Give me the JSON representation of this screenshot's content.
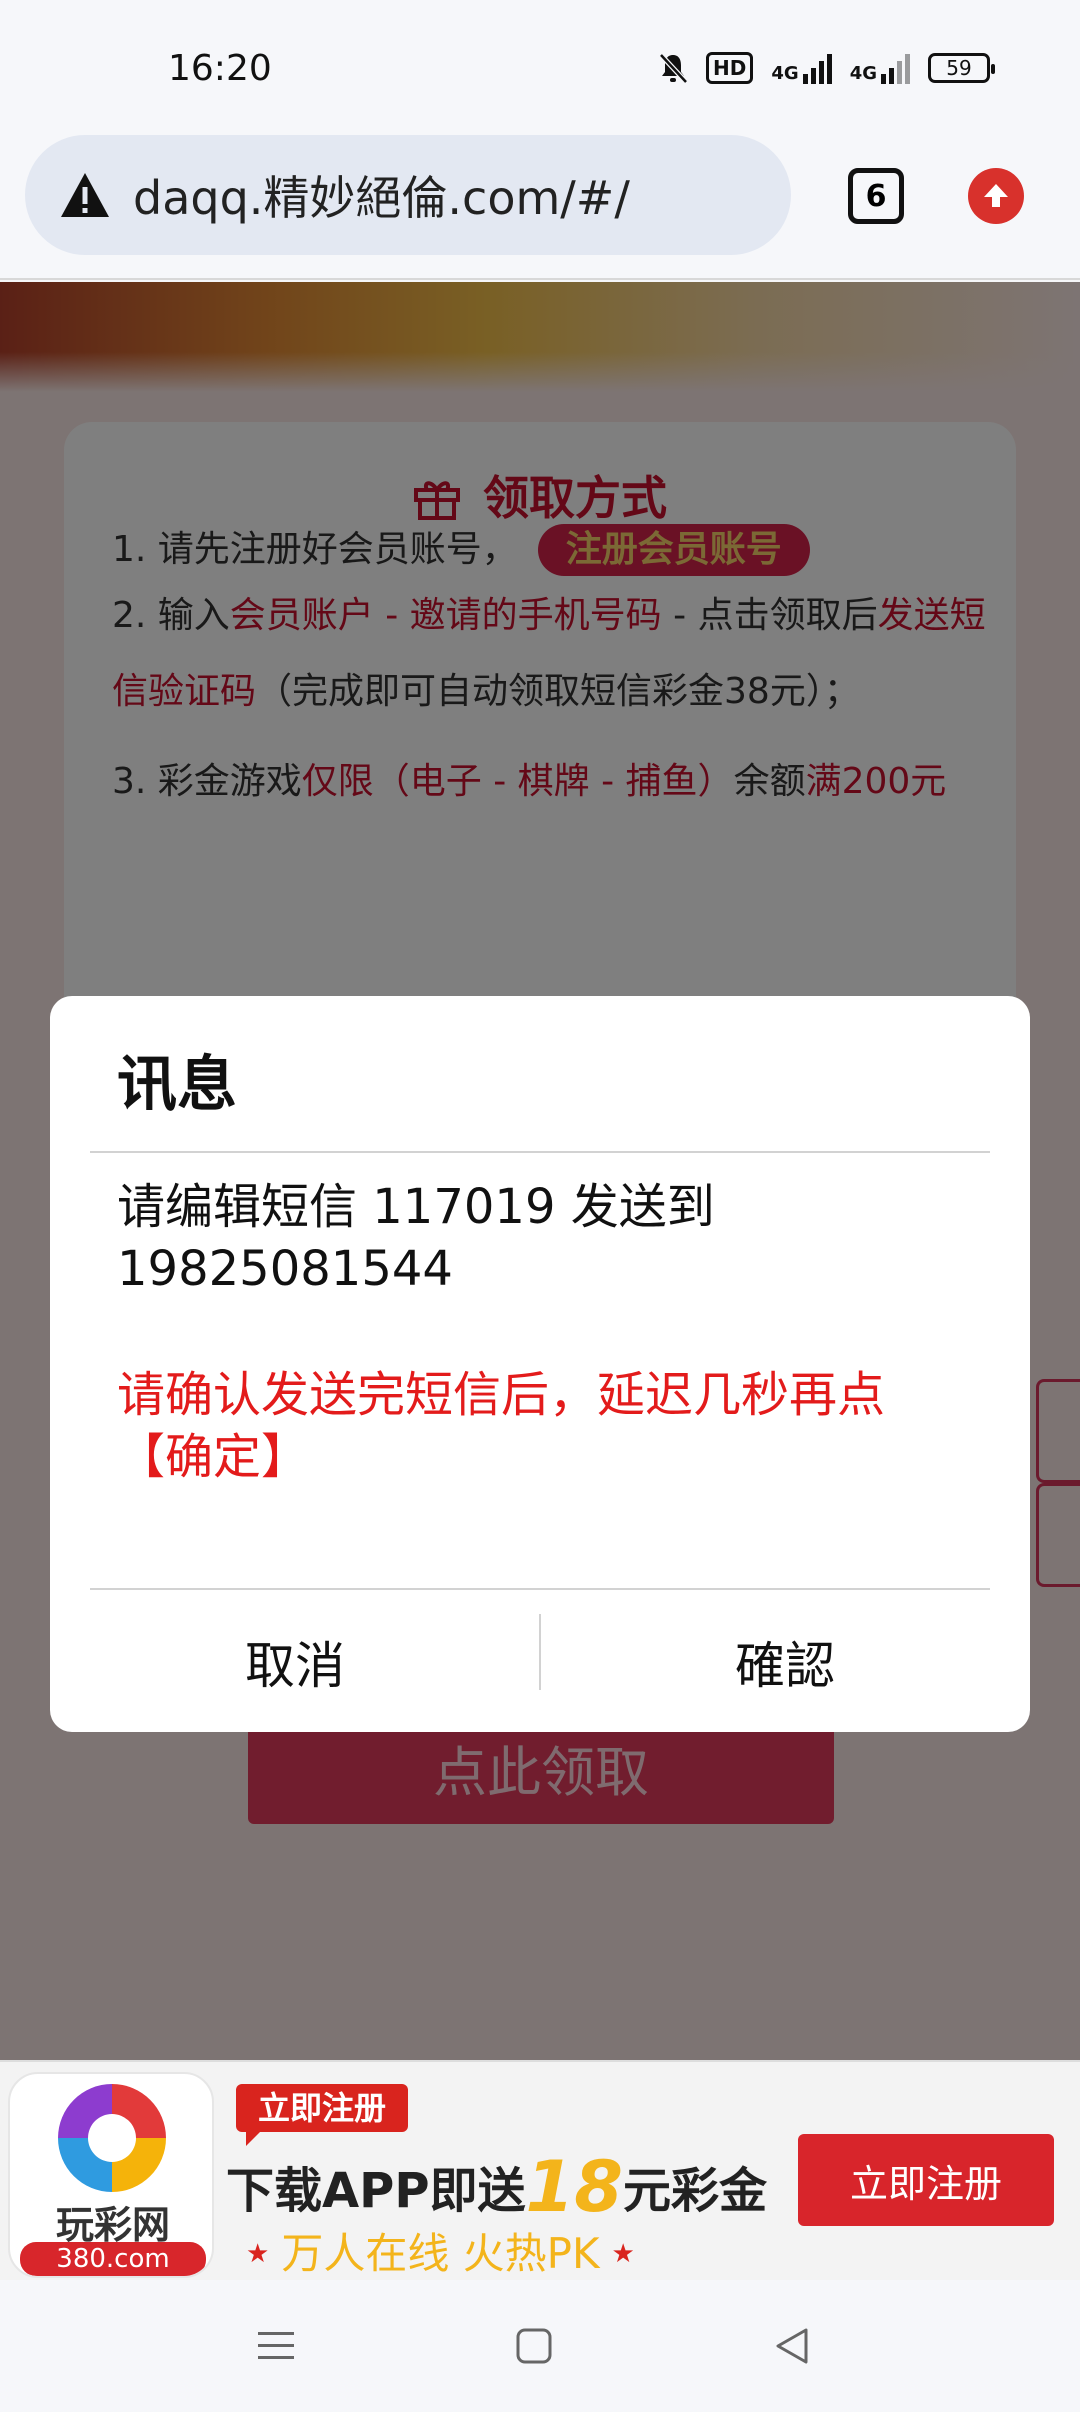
{
  "status_bar": {
    "time": "16:20",
    "icons": [
      "bell-muted-icon",
      "hd-icon",
      "signal-4g-icon",
      "signal-4g-icon"
    ],
    "hd_label": "HD",
    "network_1": "4G",
    "network_2": "4G",
    "battery": "59"
  },
  "browser": {
    "url": "daqq.精妙絕倫.com/#/",
    "tab_count": "6",
    "warning_icon": "warning-icon",
    "upgrade_icon": "arrow-up-icon"
  },
  "page": {
    "card_title": "领取方式",
    "step1_text": "1. 请先注册好会员账号，",
    "step1_button": "注册会员账号",
    "step2_prefix": "2. 输入",
    "step2_red1": "会员账户 - 邀请的手机号码",
    "step2_mid": " - 点击领取后",
    "step2_red2": "发送短信验证码",
    "step2_suffix": "（完成即可自动领取短信彩金38元）；",
    "step3_prefix": "3. 彩金游戏",
    "step3_red1": "仅限（电子 - 棋牌 - 捕鱼）",
    "step3_mid": "余额",
    "step3_red2": "满200元",
    "claim_button": "点此领取"
  },
  "dialog": {
    "title": "讯息",
    "message": "请编辑短信 117019 发送到 19825081544",
    "warning": "请确认发送完短信后，延迟几秒再点【确定】",
    "cancel_label": "取消",
    "confirm_label": "確認"
  },
  "ad": {
    "logo_name": "玩彩网",
    "logo_domain": "380.com",
    "tag": "立即注册",
    "main_prefix": "下载APP即送",
    "main_number": "18",
    "main_suffix": "元彩金",
    "sub_text": "万人在线  火热PK",
    "button": "立即注册"
  },
  "colors": {
    "accent_red": "#c8102e",
    "dialog_warning": "#e31b1b",
    "ad_red": "#d8252b",
    "ad_gold": "#f3b41b"
  }
}
